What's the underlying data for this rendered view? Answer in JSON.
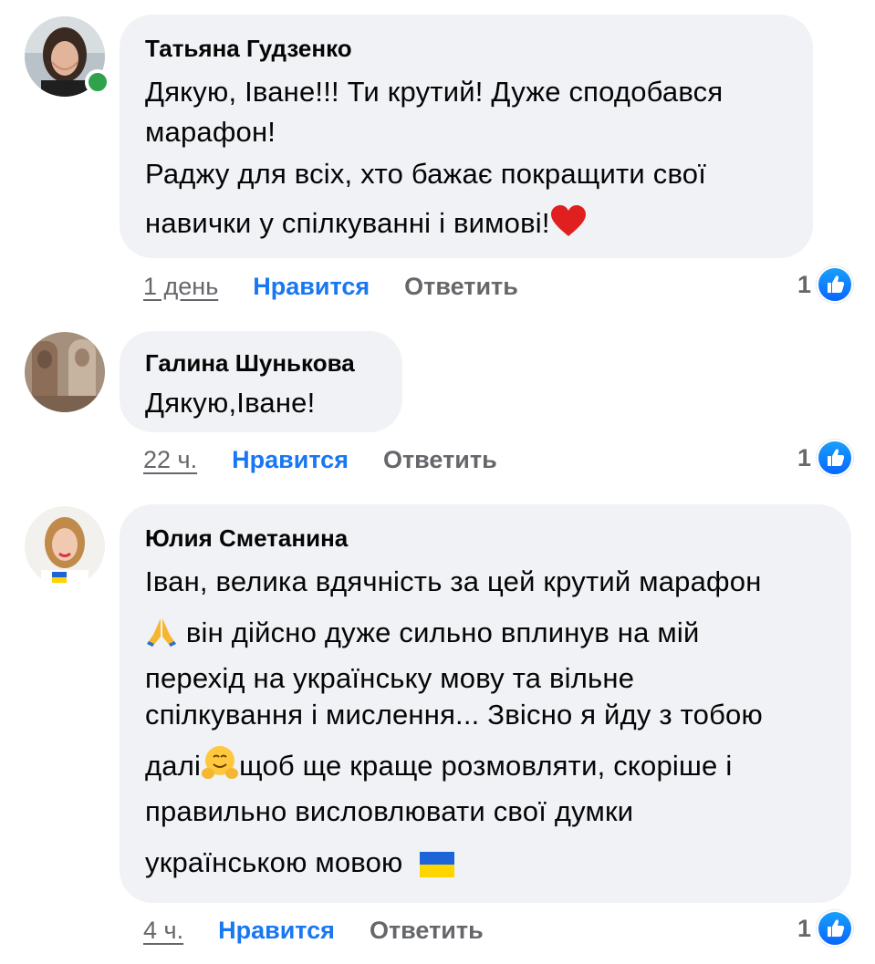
{
  "comments": [
    {
      "author": "Татьяна Гудзенко",
      "lines": [
        "Дякую, Іване!!! Ти крутий! Дуже сподобався",
        "марафон!",
        "Раджу для всіх, хто бажає покращити свої",
        "навички у спілкуванні і вимові!"
      ],
      "time": "1 день",
      "like_label": "Нравится",
      "reply_label": "Ответить",
      "reaction_count": "1",
      "online": true
    },
    {
      "author": "Галина Шунькова",
      "lines": [
        "Дякую,Іване!"
      ],
      "time": "22 ч.",
      "like_label": "Нравится",
      "reply_label": "Ответить",
      "reaction_count": "1"
    },
    {
      "author": "Юлия Сметанина",
      "lines": [
        "Іван, велика вдячність за цей крутий марафон",
        "він дійсно дуже сильно вплинув на мій",
        "перехід на українську мову та вільне",
        "спілкування і мислення... Звісно я йду з тобою",
        "далі",
        "щоб ще краще розмовляти, скоріше і",
        "правильно висловлювати свої думки",
        "українською мовою"
      ],
      "time": "4 ч.",
      "like_label": "Нравится",
      "reply_label": "Ответить",
      "reaction_count": "1"
    }
  ],
  "icons": {
    "heart": "heart-emoji",
    "pray": "folded-hands-emoji",
    "hug": "hugging-face-emoji",
    "flag": "ukraine-flag-emoji",
    "like": "thumbs-up-icon"
  },
  "colors": {
    "bubble_bg": "#f0f2f5",
    "like_blue": "#1877f2",
    "meta_gray": "#65676b",
    "online_green": "#31a24c"
  }
}
